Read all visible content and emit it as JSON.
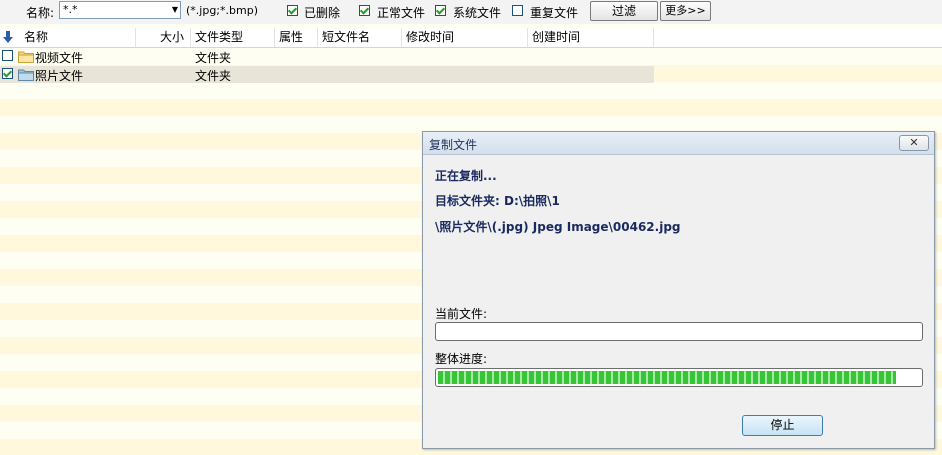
{
  "toolbar": {
    "name_label": "名称:",
    "name_value": "*.*",
    "ext_hint": "(*.jpg;*.bmp)",
    "checkboxes": [
      {
        "label": "已删除",
        "checked": true
      },
      {
        "label": "正常文件",
        "checked": true
      },
      {
        "label": "系统文件",
        "checked": true
      },
      {
        "label": "重复文件",
        "checked": false
      }
    ],
    "filter_button": "过滤",
    "more_button": "更多>>"
  },
  "columns": [
    "名称",
    "大小",
    "文件类型",
    "属性",
    "短文件名",
    "修改时间",
    "创建时间"
  ],
  "rows": [
    {
      "name": "视频文件",
      "type": "文件夹",
      "checked": false,
      "selected": false
    },
    {
      "name": "照片文件",
      "type": "文件夹",
      "checked": true,
      "selected": true
    }
  ],
  "dialog": {
    "title": "复制文件",
    "close": "✕",
    "status": "正在复制...",
    "target": "目标文件夹: D:\\拍照\\1",
    "path": "\\照片文件\\(.jpg) Jpeg Image\\00462.jpg",
    "current_file_label": "当前文件:",
    "current_progress": 0,
    "overall_label": "整体进度:",
    "overall_progress": 0.95,
    "stop_button": "停止"
  }
}
